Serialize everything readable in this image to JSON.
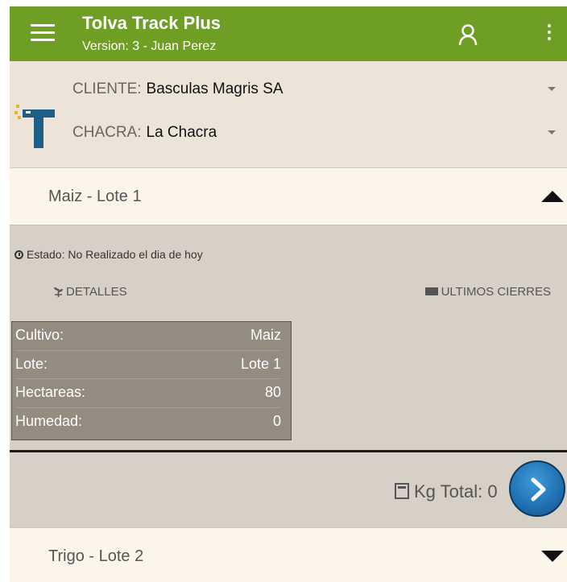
{
  "appbar": {
    "title": "Tolva Track Plus",
    "subtitle": "Version: 3 - Juan Perez",
    "color": "#6e9e24"
  },
  "selectors": {
    "cliente_label": "CLIENTE:",
    "cliente_value": "Basculas Magris SA",
    "chacra_label": "CHACRA:",
    "chacra_value": "La Chacra"
  },
  "lotes": [
    {
      "title": "Maiz - Lote 1",
      "expanded": true
    },
    {
      "title": "Trigo - Lote 2",
      "expanded": false
    }
  ],
  "detail": {
    "estado": "Estado: No Realizado el dia de hoy",
    "detalles_label": "DETALLES",
    "cierres_label": "ULTIMOS CIERRES",
    "info": [
      {
        "key": "Cultivo:",
        "value": "Maiz"
      },
      {
        "key": "Lote:",
        "value": "Lote 1"
      },
      {
        "key": "Hectareas:",
        "value": "80"
      },
      {
        "key": "Humedad:",
        "value": "0"
      }
    ],
    "kg_total": "Kg Total: 0"
  },
  "icons": [
    "menu-icon",
    "user-icon",
    "more-vert-icon",
    "clock-icon",
    "sprout-icon",
    "truck-icon",
    "calculator-icon",
    "chevron-right-icon"
  ]
}
